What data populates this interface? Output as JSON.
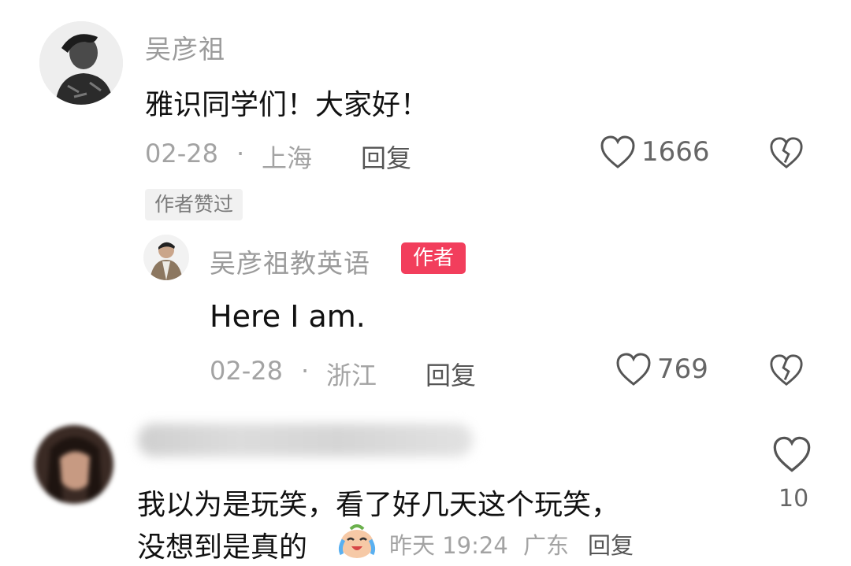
{
  "comment1": {
    "username": "吴彦祖",
    "text": "雅识同学们！大家好！",
    "date": "02-28",
    "location": "上海",
    "reply_label": "回复",
    "likes": "1666",
    "liked_tag": "作者赞过"
  },
  "reply1": {
    "username": "吴彦祖教英语",
    "badge": "作者",
    "text": "Here I am.",
    "date": "02-28",
    "location": "浙江",
    "reply_label": "回复",
    "likes": "769"
  },
  "comment2": {
    "text_line1": "我以为是玩笑，看了好几天这个玩笑，",
    "text_line2": "没想到是真的",
    "time": "昨天 19:24",
    "location": "广东",
    "reply_label": "回复",
    "likes": "10"
  },
  "icons": {
    "like": "heart-outline-icon",
    "dislike": "broken-heart-icon",
    "emoji": "crying-laughing-emoji-icon"
  },
  "colors": {
    "author_badge": "#f23e5c",
    "muted_text": "#9b9b9b"
  }
}
